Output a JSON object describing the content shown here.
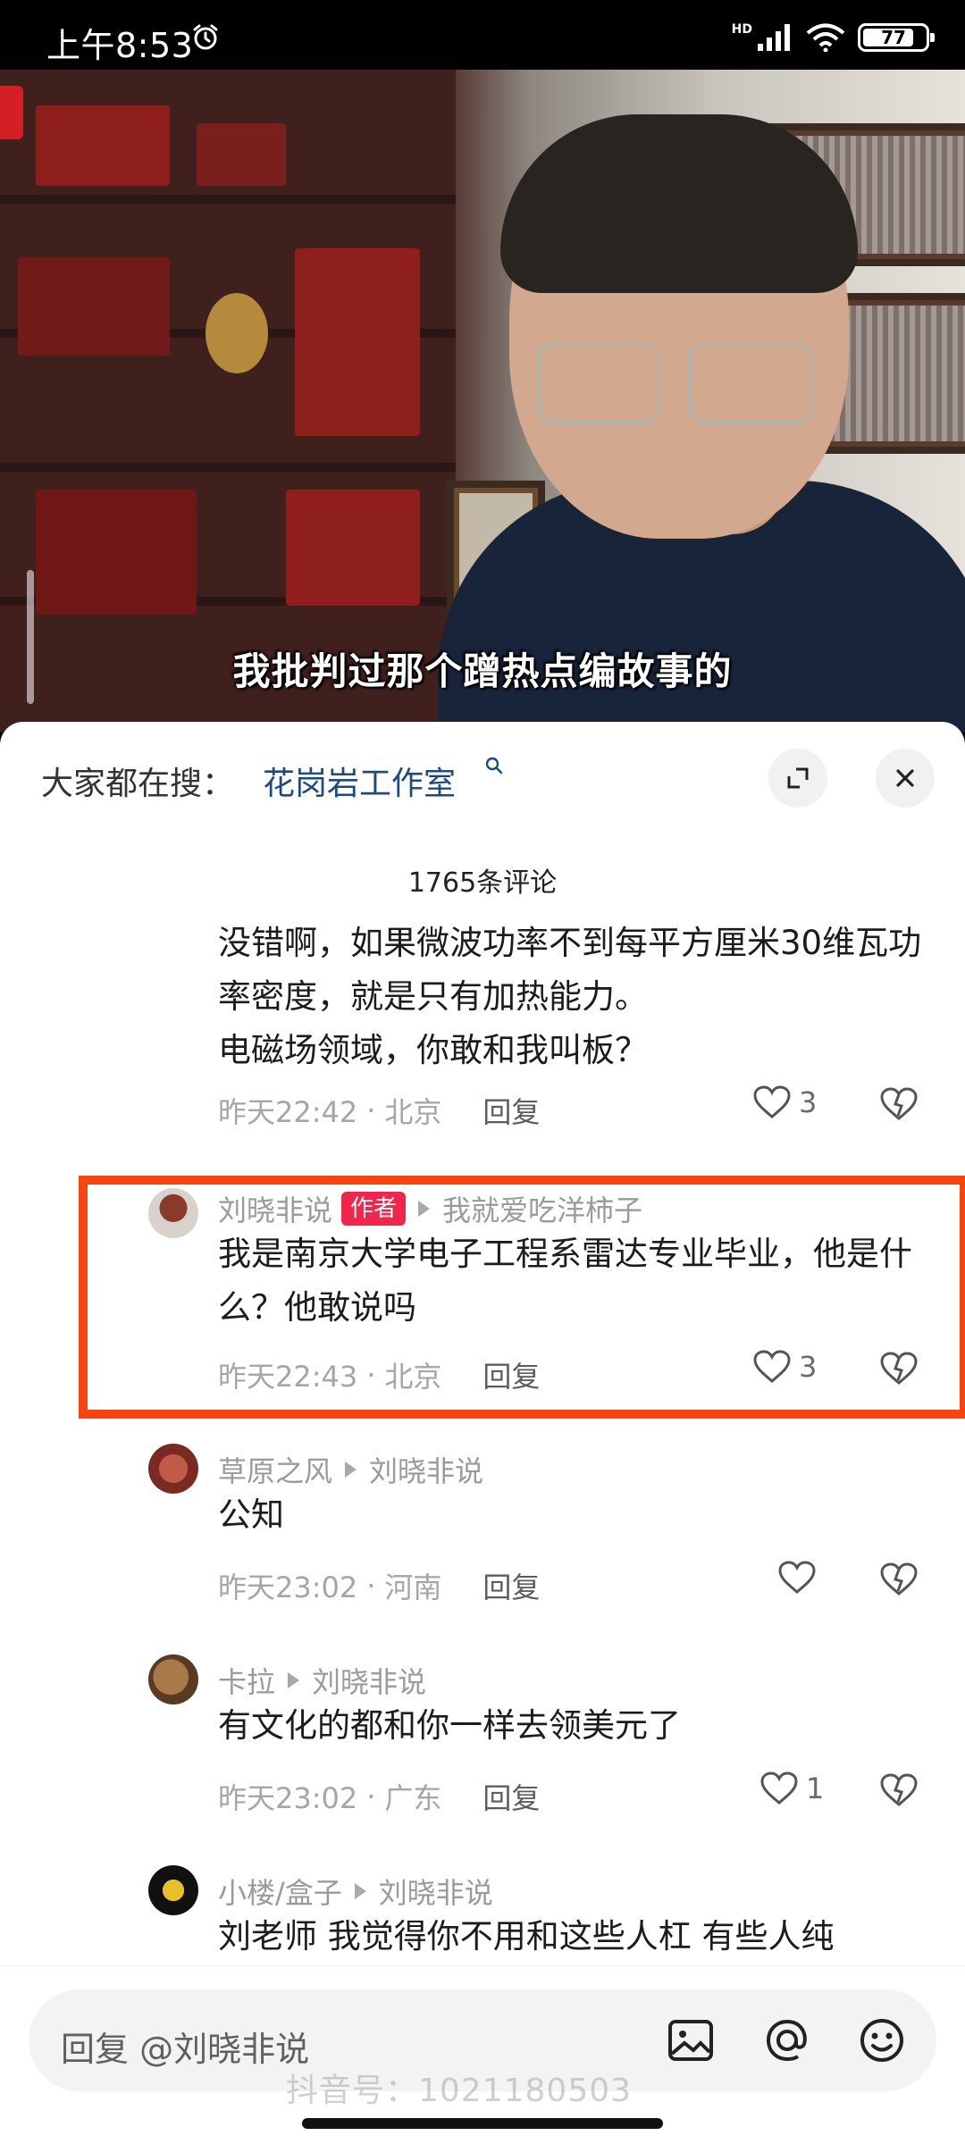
{
  "status_bar": {
    "time": "上午8:53",
    "network": "HD",
    "battery": "77"
  },
  "video": {
    "subtitle": "我批判过那个蹭热点编故事的"
  },
  "search": {
    "prefix": "大家都在搜：",
    "term": "花岗岩工作室"
  },
  "comments_header": {
    "count": "1765条评论"
  },
  "comments": [
    {
      "text": "没错啊，如果微波功率不到每平方厘米30维瓦功率密度，就是只有加热能力。\n电磁场领域，你敢和我叫板？",
      "time": "昨天22:42",
      "location": "北京",
      "reply": "回复",
      "likes": "3"
    },
    {
      "user": "刘晓非说",
      "tag": "作者",
      "reply_to": "我就爱吃洋柿子",
      "text": "我是南京大学电子工程系雷达专业毕业，他是什么？他敢说吗",
      "time": "昨天22:43",
      "location": "北京",
      "reply": "回复",
      "likes": "3"
    },
    {
      "user": "草原之风",
      "reply_to": "刘晓非说",
      "text": "公知",
      "time": "昨天23:02",
      "location": "河南",
      "reply": "回复",
      "likes": ""
    },
    {
      "user": "卡拉",
      "reply_to": "刘晓非说",
      "text": "有文化的都和你一样去领美元了",
      "time": "昨天23:02",
      "location": "广东",
      "reply": "回复",
      "likes": "1"
    },
    {
      "user": "小楼/盒子",
      "reply_to": "刘晓非说",
      "text": "刘老师 我觉得你不用和这些人杠 有些人纯",
      "time": "",
      "location": "",
      "reply": "",
      "likes": ""
    }
  ],
  "reply_input": {
    "placeholder": "回复 @刘晓非说"
  },
  "watermark": "抖音号：1021180503",
  "colors": {
    "author_tag": "#f1264c",
    "highlight_border": "#f8450f",
    "search_link": "#1f4a80"
  }
}
